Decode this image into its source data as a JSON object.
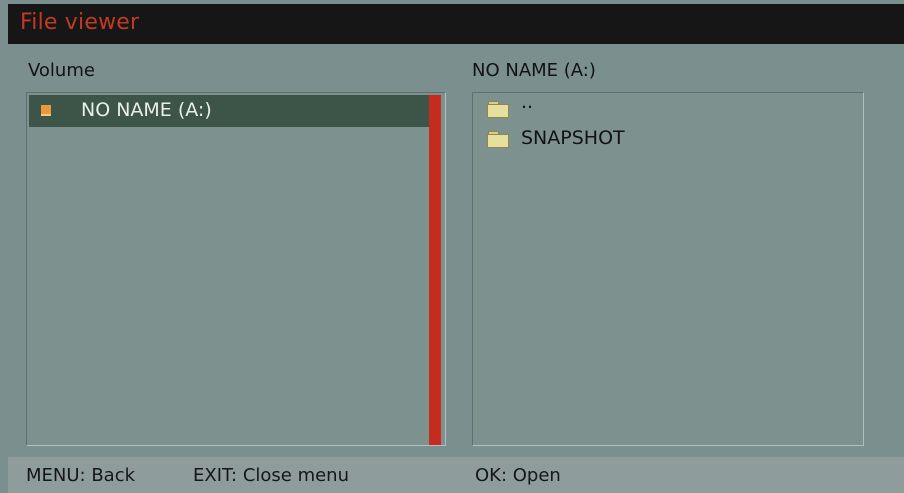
{
  "window": {
    "title": "File viewer"
  },
  "volume_panel": {
    "title": "Volume",
    "items": [
      {
        "label": "NO NAME (A:)",
        "icon": "drive-icon",
        "selected": true
      }
    ]
  },
  "file_panel": {
    "title": "NO NAME (A:)",
    "items": [
      {
        "label": "..",
        "icon": "folder-icon"
      },
      {
        "label": "SNAPSHOT",
        "icon": "folder-icon"
      }
    ]
  },
  "status_bar": {
    "menu_hint": "MENU: Back",
    "exit_hint": "EXIT: Close menu",
    "ok_hint": "OK: Open"
  },
  "colors": {
    "title_text": "#c23a22",
    "title_bar": "#161616",
    "background": "#7b908e",
    "selected_row": "#3d5448",
    "scrollbar": "#c62b1f",
    "status_bar": "#8e9d9b"
  }
}
